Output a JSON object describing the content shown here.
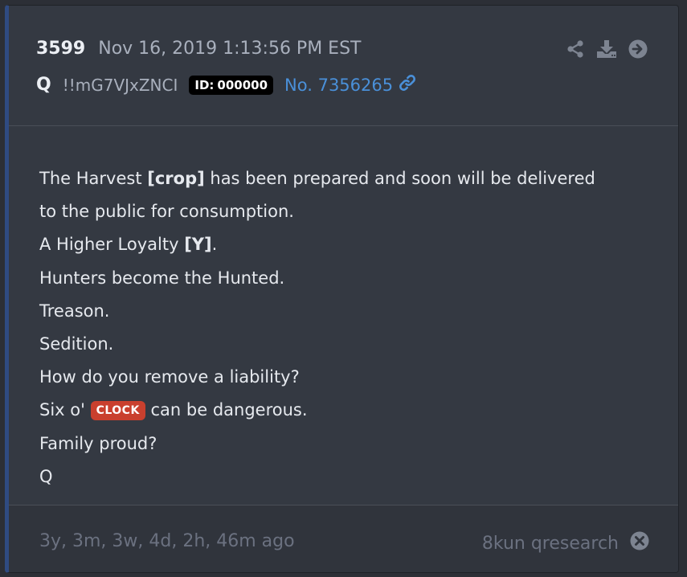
{
  "header": {
    "post_number": "3599",
    "timestamp": "Nov 16, 2019 1:13:56 PM EST",
    "author": "Q",
    "tripcode": "!!mG7VJxZNCI",
    "id_label": "ID:",
    "id_value": "000000",
    "post_no": "No. 7356265",
    "icons": [
      "share-icon",
      "download-icon",
      "arrow-circle-right-icon",
      "link-icon"
    ]
  },
  "body": {
    "line1_a": "The Harvest ",
    "line1_b": "[crop]",
    "line1_c": " has been prepared and soon will be delivered",
    "line2": "to the public for consumption.",
    "line3_a": "A Higher Loyalty ",
    "line3_b": "[Y]",
    "line3_c": ".",
    "line4": "Hunters become the Hunted.",
    "line5": "Treason.",
    "line6": "Sedition.",
    "line7": "How do you remove a liability?",
    "line8_a": "Six o' ",
    "line8_badge": "CLOCK",
    "line8_c": " can be dangerous.",
    "line9": "Family proud?",
    "line10": "Q"
  },
  "footer": {
    "ago": "3y, 3m, 3w, 4d, 2h, 46m ago",
    "source": "8kun qresearch",
    "close_icon": "close-circle-icon"
  },
  "colors": {
    "background": "#343942",
    "accent_border": "#2f4b82",
    "link": "#4a90d9",
    "badge_red": "#c9402e"
  }
}
